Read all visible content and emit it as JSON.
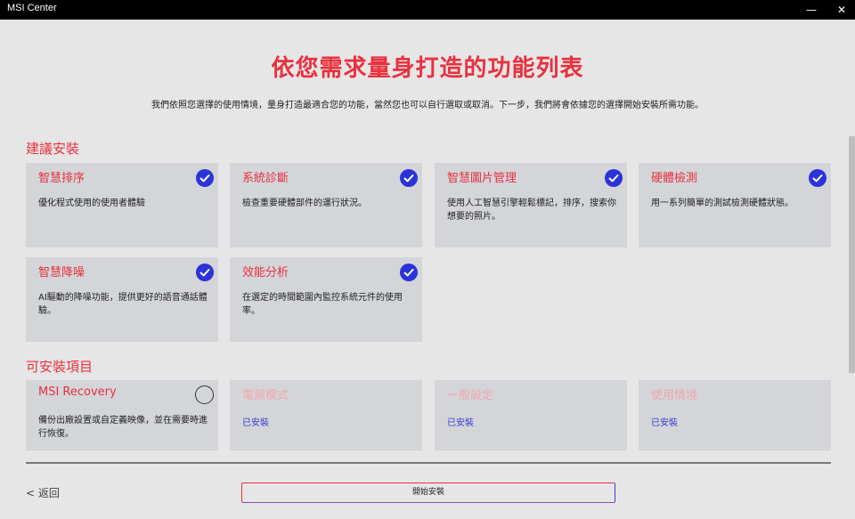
{
  "window": {
    "title": "MSI Center",
    "minimize_glyph": "—",
    "close_glyph": "✕"
  },
  "header": {
    "title": "依您需求量身打造的功能列表",
    "subtitle": "我們依照您選擇的使用情境，量身打造最適合您的功能，當然您也可以自行選取或取消。下一步，我們將會依據您的選擇開始安裝所需功能。"
  },
  "recommended": {
    "title": "建議安裝",
    "items": [
      {
        "name": "智慧排序",
        "desc": "優化程式使用的使用者體驗",
        "selected": true
      },
      {
        "name": "系統診斷",
        "desc": "檢查重要硬體部件的運行狀況。",
        "selected": true
      },
      {
        "name": "智慧圖片管理",
        "desc": "使用人工智慧引擎輕鬆標記，排序，搜索你想要的照片。",
        "selected": true
      },
      {
        "name": "硬體檢測",
        "desc": "用一系列簡單的測試檢測硬體狀態。",
        "selected": true
      },
      {
        "name": "智慧降噪",
        "desc": "AI驅動的降噪功能，提供更好的語音通話體驗。",
        "selected": true
      },
      {
        "name": "效能分析",
        "desc": "在選定的時間範圍內監控系統元件的使用率。",
        "selected": true
      }
    ]
  },
  "installable": {
    "title": "可安裝項目",
    "items": [
      {
        "name": "MSI Recovery",
        "desc": "備份出廠設置或自定義映像，並在需要時進行恢復。",
        "selected": false
      },
      {
        "name": "電競模式",
        "status": "已安裝"
      },
      {
        "name": "一般設定",
        "status": "已安裝"
      },
      {
        "name": "使用情境",
        "status": "已安裝"
      }
    ]
  },
  "footer": {
    "back_label": "< 返回",
    "install_label": "開始安裝"
  },
  "colors": {
    "accent_red": "#e8313f",
    "check_blue": "#2b34d8",
    "card_bg": "#d3d5d9"
  }
}
